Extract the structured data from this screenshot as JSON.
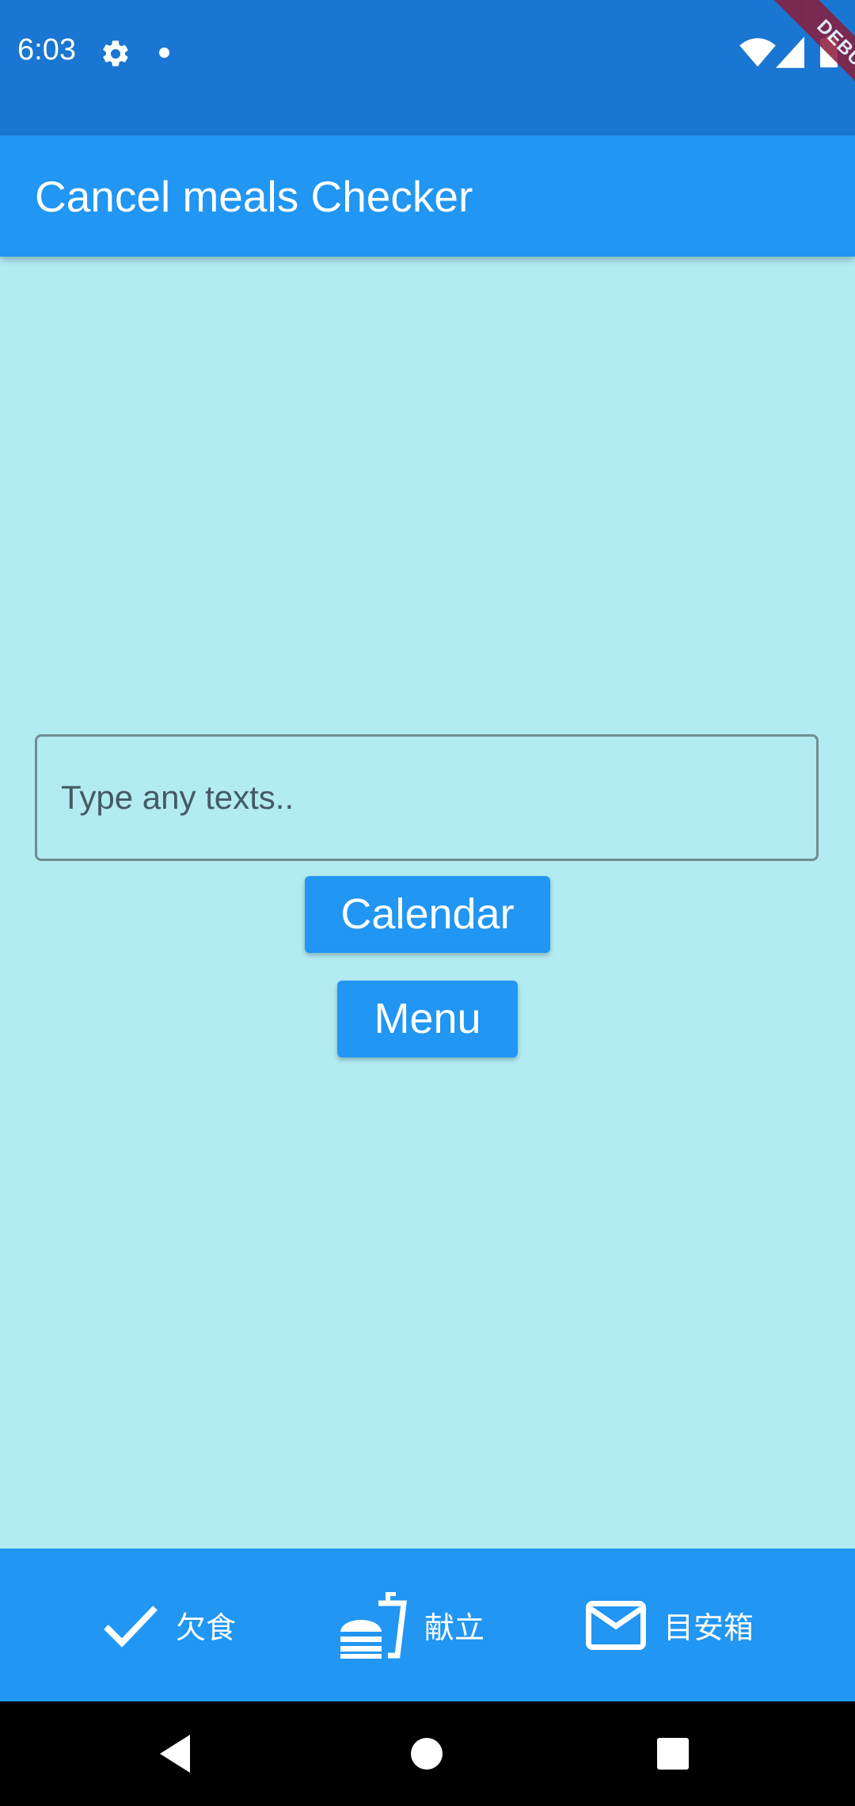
{
  "status_bar": {
    "time": "6:03",
    "icons": [
      "gear-icon",
      "dot-icon",
      "wifi-icon",
      "signal-icon",
      "battery-icon"
    ],
    "background": "#1976d2"
  },
  "debug_banner": {
    "label": "DEBUG"
  },
  "app_bar": {
    "title": "Cancel meals Checker",
    "background": "#2196f3"
  },
  "main": {
    "background": "#b2ebf2",
    "text_field": {
      "placeholder": "Type any texts..",
      "value": ""
    },
    "buttons": {
      "calendar": "Calendar",
      "menu": "Menu"
    }
  },
  "bottom_nav": {
    "items": [
      {
        "icon": "check-icon",
        "label": "欠食"
      },
      {
        "icon": "fastfood-icon",
        "label": "献立"
      },
      {
        "icon": "mail-icon",
        "label": "目安箱"
      }
    ]
  },
  "system_nav": {
    "icons": [
      "back-icon",
      "home-icon",
      "recents-icon"
    ]
  }
}
